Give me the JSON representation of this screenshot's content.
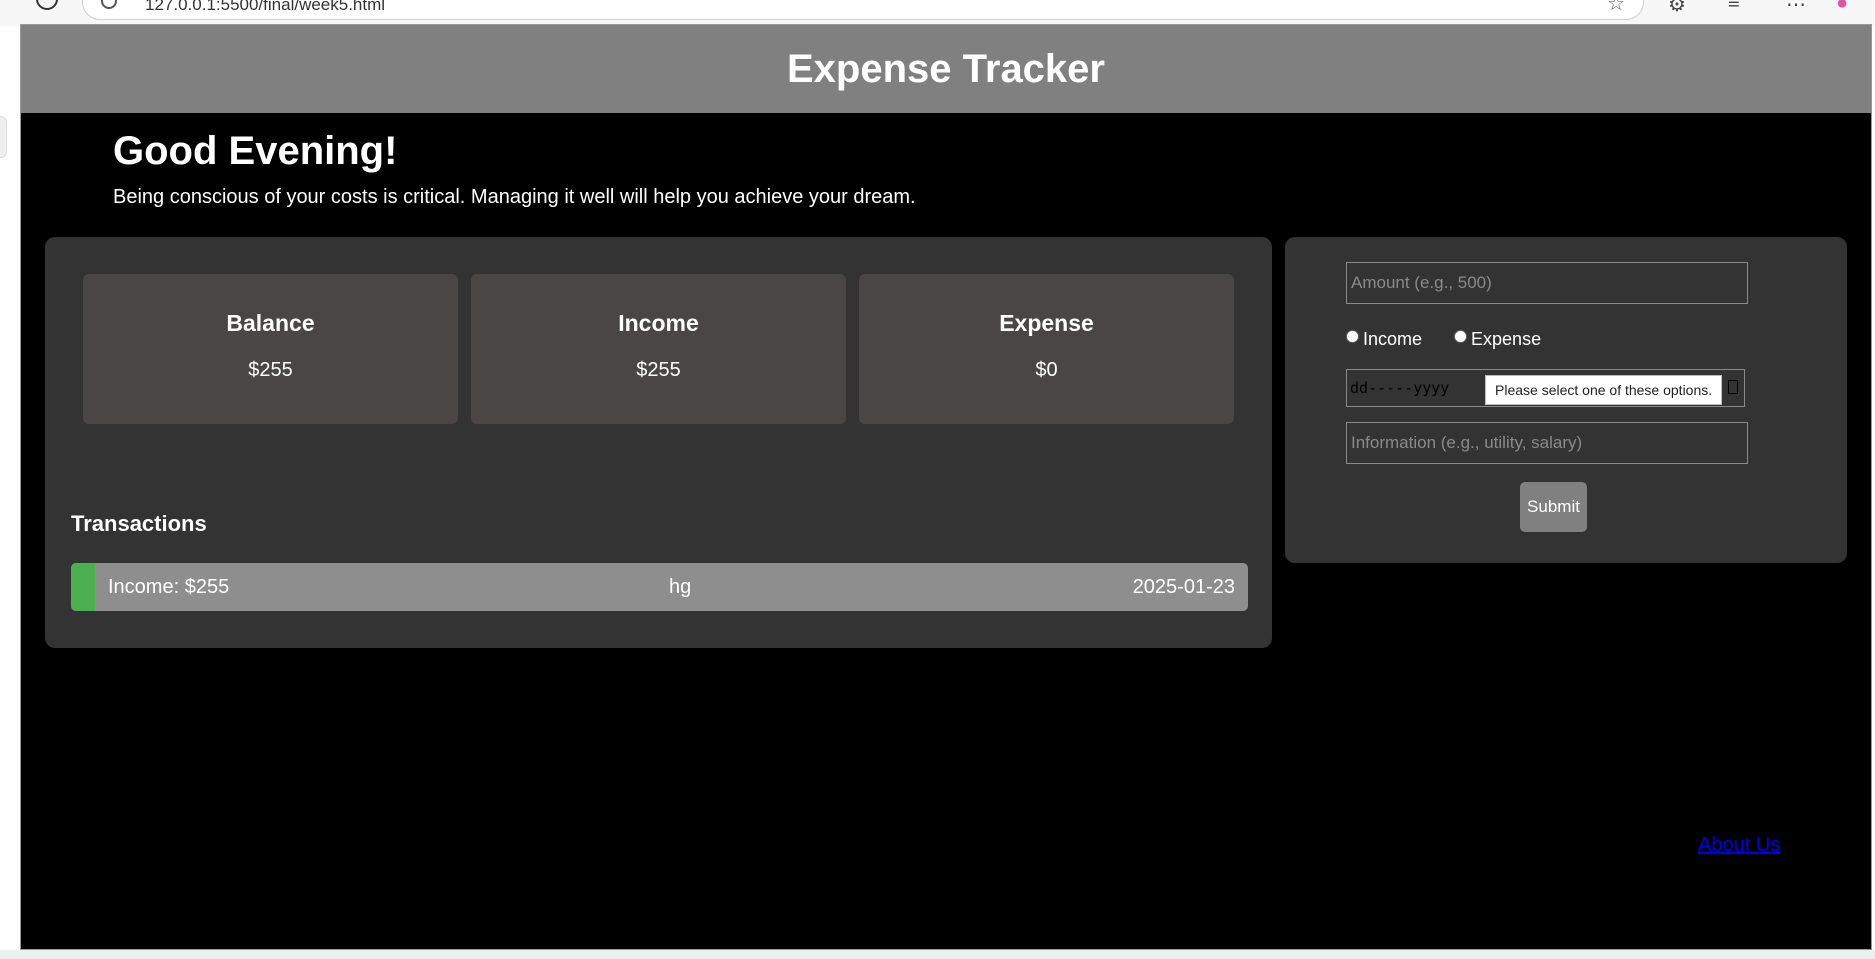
{
  "browser": {
    "url": "127.0.0.1:5500/final/week5.html"
  },
  "header": {
    "title": "Expense Tracker"
  },
  "intro": {
    "greeting": "Good Evening!",
    "tagline": "Being conscious of your costs is critical. Managing it well will help you achieve your dream."
  },
  "summary": {
    "balance": {
      "label": "Balance",
      "value": "$255"
    },
    "income": {
      "label": "Income",
      "value": "$255"
    },
    "expense": {
      "label": "Expense",
      "value": "$0"
    }
  },
  "transactions": {
    "heading": "Transactions",
    "items": [
      {
        "type_amount": "Income: $255",
        "info": "hg",
        "date": "2025-01-23",
        "accent": "#4caf50"
      }
    ]
  },
  "form": {
    "amount_placeholder": "Amount (e.g., 500)",
    "radio_income": "Income",
    "radio_expense": "Expense",
    "date_format": "dd-----yyyy",
    "validation_tooltip": "Please select one of these options.",
    "info_placeholder": "Information (e.g., utility, salary)",
    "submit_label": "Submit"
  },
  "footer": {
    "about_link": "About Us"
  },
  "colors": {
    "header_bg": "#808080",
    "panel_bg": "#333333",
    "card_bg": "#4a4646",
    "transaction_bg": "#8f8e8e",
    "income_accent": "#4caf50",
    "link": "#0000ee"
  }
}
